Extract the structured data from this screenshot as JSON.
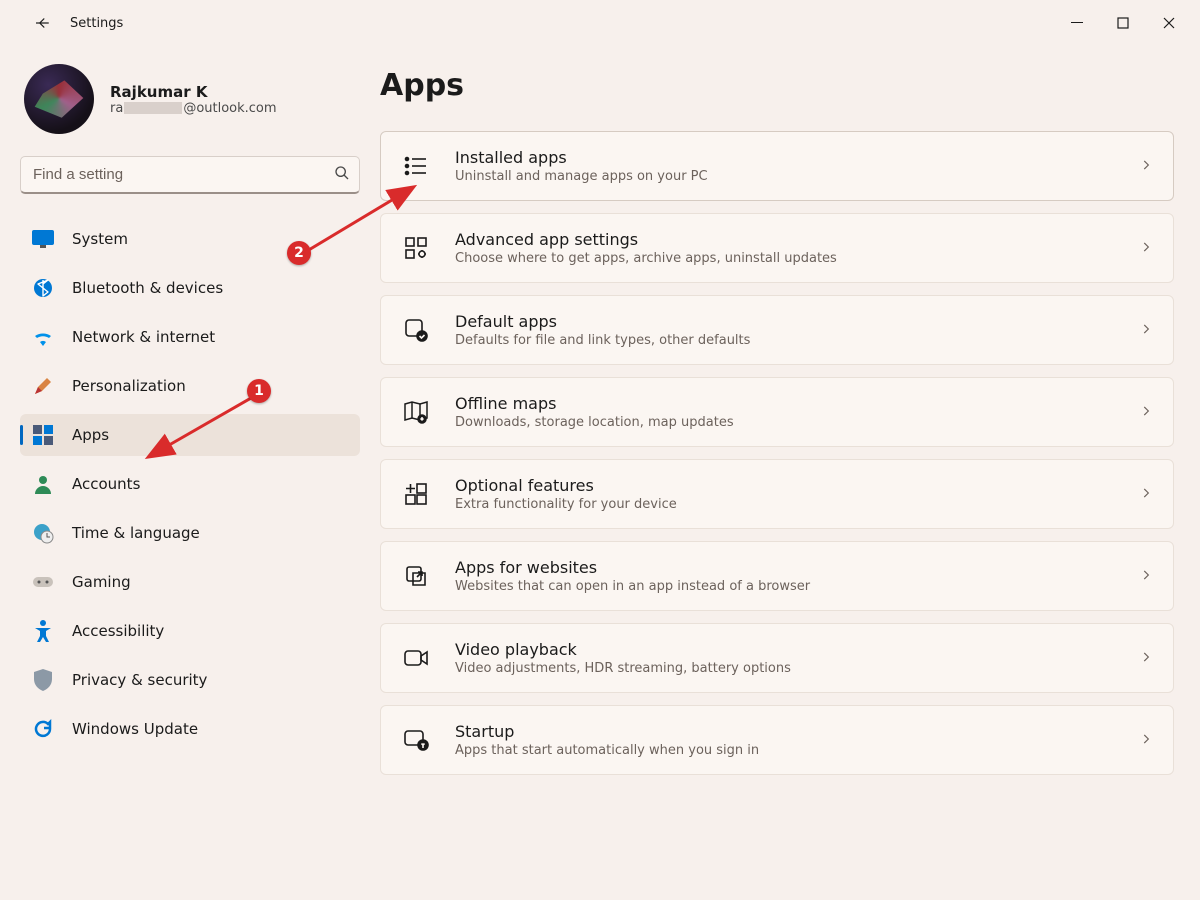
{
  "window": {
    "title": "Settings"
  },
  "profile": {
    "name": "Rajkumar K",
    "email_prefix": "ra",
    "email_suffix": "@outlook.com"
  },
  "search": {
    "placeholder": "Find a setting"
  },
  "nav": {
    "items": [
      {
        "id": "system",
        "label": "System"
      },
      {
        "id": "bluetooth",
        "label": "Bluetooth & devices"
      },
      {
        "id": "network",
        "label": "Network & internet"
      },
      {
        "id": "personalization",
        "label": "Personalization"
      },
      {
        "id": "apps",
        "label": "Apps",
        "active": true
      },
      {
        "id": "accounts",
        "label": "Accounts"
      },
      {
        "id": "time",
        "label": "Time & language"
      },
      {
        "id": "gaming",
        "label": "Gaming"
      },
      {
        "id": "accessibility",
        "label": "Accessibility"
      },
      {
        "id": "privacy",
        "label": "Privacy & security"
      },
      {
        "id": "update",
        "label": "Windows Update"
      }
    ]
  },
  "page": {
    "title": "Apps"
  },
  "cards": [
    {
      "title": "Installed apps",
      "sub": "Uninstall and manage apps on your PC"
    },
    {
      "title": "Advanced app settings",
      "sub": "Choose where to get apps, archive apps, uninstall updates"
    },
    {
      "title": "Default apps",
      "sub": "Defaults for file and link types, other defaults"
    },
    {
      "title": "Offline maps",
      "sub": "Downloads, storage location, map updates"
    },
    {
      "title": "Optional features",
      "sub": "Extra functionality for your device"
    },
    {
      "title": "Apps for websites",
      "sub": "Websites that can open in an app instead of a browser"
    },
    {
      "title": "Video playback",
      "sub": "Video adjustments, HDR streaming, battery options"
    },
    {
      "title": "Startup",
      "sub": "Apps that start automatically when you sign in"
    }
  ],
  "annotations": {
    "1": "1",
    "2": "2"
  }
}
